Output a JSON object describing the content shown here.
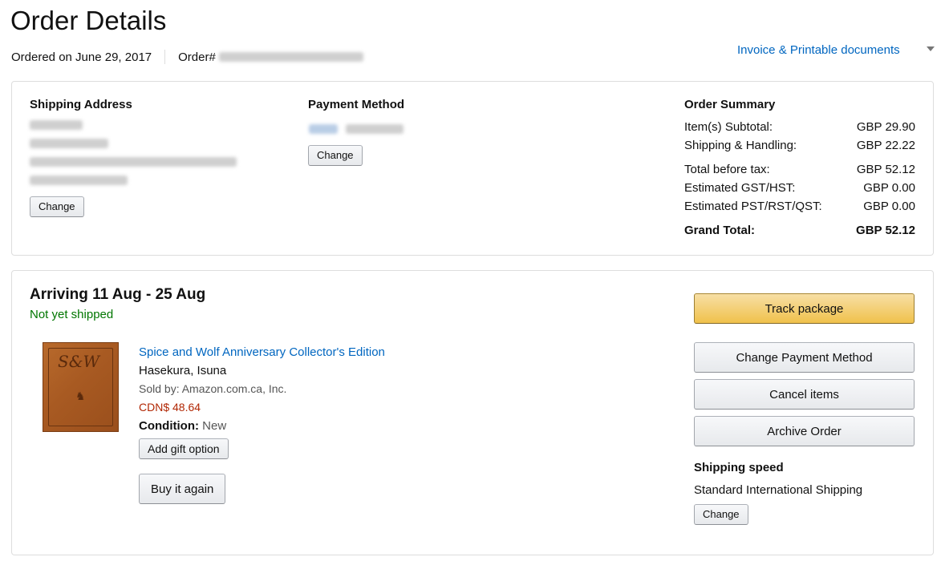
{
  "page": {
    "title": "Order Details",
    "ordered_on": "Ordered on June 29, 2017",
    "order_label": "Order#",
    "invoice_link": "Invoice & Printable documents"
  },
  "shipping_address": {
    "title": "Shipping Address",
    "change_label": "Change"
  },
  "payment_method": {
    "title": "Payment Method",
    "change_label": "Change"
  },
  "order_summary": {
    "title": "Order Summary",
    "rows": [
      {
        "label": "Item(s) Subtotal:",
        "value": "GBP 29.90"
      },
      {
        "label": "Shipping & Handling:",
        "value": "GBP 22.22"
      },
      {
        "label": "Total before tax:",
        "value": "GBP 52.12"
      },
      {
        "label": "Estimated GST/HST:",
        "value": "GBP 0.00"
      },
      {
        "label": "Estimated PST/RST/QST:",
        "value": "GBP 0.00"
      }
    ],
    "grand_total_label": "Grand Total:",
    "grand_total_value": "GBP 52.12"
  },
  "shipment": {
    "arriving": "Arriving 11 Aug - 25 Aug",
    "status": "Not yet shipped",
    "status_color": "#007600",
    "item": {
      "title": "Spice and Wolf Anniversary Collector's Edition",
      "author": "Hasekura, Isuna",
      "seller": "Sold by: Amazon.com.ca, Inc.",
      "price": "CDN$ 48.64",
      "condition_label": "Condition:",
      "condition_value": "New",
      "gift_button": "Add gift option",
      "buy_again_button": "Buy it again"
    },
    "actions": {
      "track": "Track package",
      "change_payment": "Change Payment Method",
      "cancel": "Cancel items",
      "archive": "Archive Order"
    },
    "shipping_speed": {
      "title": "Shipping speed",
      "value": "Standard International Shipping",
      "change_label": "Change"
    }
  }
}
